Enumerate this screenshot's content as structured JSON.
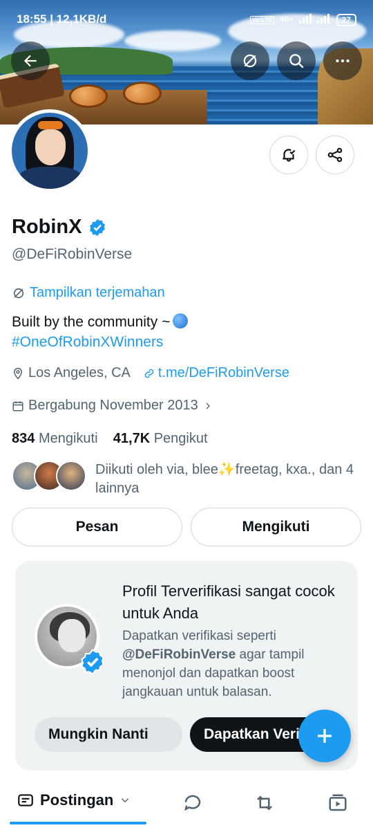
{
  "status_bar": {
    "time_speed": "18:55 | 12,1KB/d",
    "network": "4G+",
    "battery": "27"
  },
  "profile": {
    "name": "RobinX",
    "handle": "@DeFiRobinVerse",
    "translate_label": "Tampilkan terjemahan",
    "bio_line1": "Built by the community ~",
    "bio_hashtag": "#OneOfRobinXWinners",
    "location": "Los Angeles, CA",
    "website": "t.me/DeFiRobinVerse",
    "joined": "Bergabung November 2013",
    "following_count": "834",
    "following_label": "Mengikuti",
    "followers_count": "41,7K",
    "followers_label": "Pengikut",
    "followed_by": "Diikuti oleh via, blee✨freetag, kxa., dan 4 lainnya"
  },
  "buttons": {
    "message": "Pesan",
    "following": "Mengikuti"
  },
  "verify_card": {
    "title": "Profil Terverifikasi sangat cocok untuk Anda",
    "desc_prefix": "Dapatkan verifikasi seperti",
    "desc_handle": "@DeFiRobinVerse",
    "desc_suffix": "agar tampil menonjol dan dapatkan boost jangkauan untuk balasan.",
    "later_button": "Mungkin Nanti",
    "get_button": "Dapatkan Verifikasi"
  },
  "tabs": {
    "posts": "Postingan"
  },
  "colors": {
    "accent": "#1d9bf0",
    "secondary_text": "#536471"
  }
}
